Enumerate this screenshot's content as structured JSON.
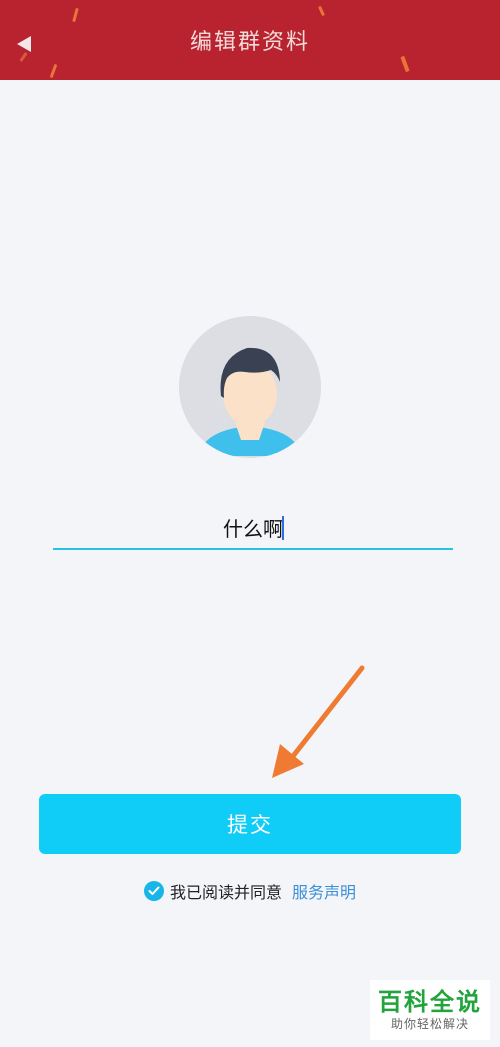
{
  "header": {
    "title": "编辑群资料",
    "back_icon": "back-arrow-icon",
    "background_color": "#b8232f"
  },
  "profile": {
    "avatar_icon": "default-avatar-icon",
    "group_name_value": "什么啊"
  },
  "submit": {
    "label": "提交",
    "color": "#0fcdf6"
  },
  "agreement": {
    "checked": true,
    "text": "我已阅读并同意",
    "link_text": "服务声明",
    "link_color": "#3d8fd6"
  },
  "watermark": {
    "main": "百科全说",
    "sub": "助你轻松解决"
  }
}
